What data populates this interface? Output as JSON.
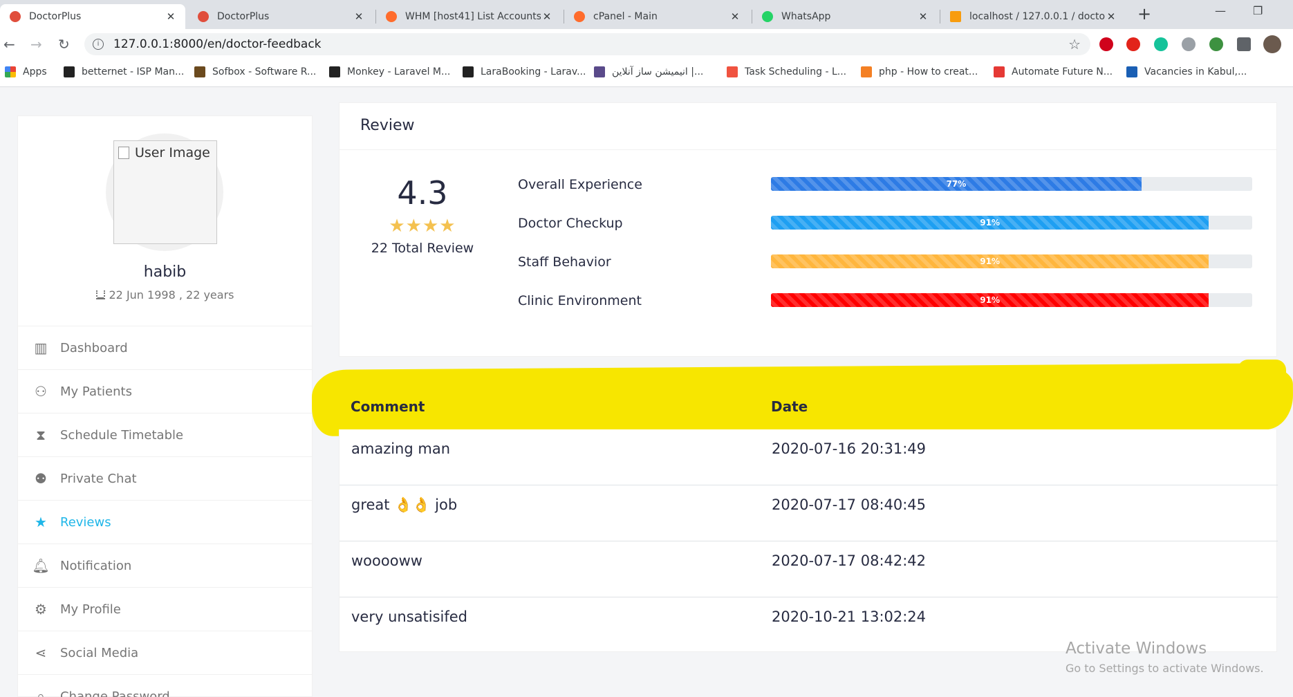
{
  "browser": {
    "tabs": [
      {
        "title": "DoctorPlus",
        "active": true
      },
      {
        "title": "DoctorPlus",
        "active": false
      },
      {
        "title": "WHM [host41] List Accounts",
        "active": false
      },
      {
        "title": "cPanel - Main",
        "active": false
      },
      {
        "title": "WhatsApp",
        "active": false
      },
      {
        "title": "localhost / 127.0.0.1 / doctor",
        "active": false
      }
    ],
    "url": "127.0.0.1:8000/en/doctor-feedback",
    "bookmarks": [
      "Apps",
      "betternet - ISP Man...",
      "Sofbox - Software R...",
      "Monkey - Laravel M...",
      "LaraBooking - Larav...",
      "انیمیشن ساز آنلاین |...",
      "Task Scheduling - L...",
      "php - How to creat...",
      "Automate Future N...",
      "Vacancies in Kabul,..."
    ],
    "extensions": [
      "abp-icon",
      "shield-icon",
      "grammarly-icon",
      "cloud-icon",
      "globe-icon",
      "puzzle-icon",
      "avatar"
    ]
  },
  "profile": {
    "image_alt": "User Image",
    "name": "habib",
    "dob": "22 Jun 1998 , 22 years"
  },
  "menu": [
    {
      "label": "Dashboard",
      "icon": "dashboard-icon",
      "active": false
    },
    {
      "label": "My Patients",
      "icon": "patients-icon",
      "active": false
    },
    {
      "label": "Schedule Timetable",
      "icon": "hourglass-icon",
      "active": false
    },
    {
      "label": "Private Chat",
      "icon": "chat-icon",
      "active": false
    },
    {
      "label": "Reviews",
      "icon": "star-icon",
      "active": true
    },
    {
      "label": "Notification",
      "icon": "bell-icon",
      "active": false
    },
    {
      "label": "My Profile",
      "icon": "user-cog-icon",
      "active": false
    },
    {
      "label": "Social Media",
      "icon": "share-icon",
      "active": false
    },
    {
      "label": "Change Password",
      "icon": "lock-icon",
      "active": false
    }
  ],
  "review": {
    "title": "Review",
    "rating": "4.3",
    "stars": "★★★★",
    "total": "22 Total Review",
    "metrics": [
      {
        "label": "Overall Experience",
        "percent": 77,
        "text": "77%",
        "color": "#2d7be5"
      },
      {
        "label": "Doctor Checkup",
        "percent": 91,
        "text": "91%",
        "color": "#1e9ff2"
      },
      {
        "label": "Staff Behavior",
        "percent": 91,
        "text": "91%",
        "color": "#ffb63d"
      },
      {
        "label": "Clinic Environment",
        "percent": 91,
        "text": "91%",
        "color": "#ff0000"
      }
    ]
  },
  "comments": {
    "headers": {
      "comment": "Comment",
      "date": "Date"
    },
    "rows": [
      {
        "comment": "amazing man",
        "date": "2020-07-16 20:31:49"
      },
      {
        "comment": "great 👌👌 job",
        "date": "2020-07-17 08:40:45"
      },
      {
        "comment": "wooooww",
        "date": "2020-07-17 08:42:42"
      },
      {
        "comment": "very unsatisifed",
        "date": "2020-10-21 13:02:24"
      }
    ]
  },
  "watermark": {
    "line1": "Activate Windows",
    "line2": "Go to Settings to activate Windows."
  },
  "colors": {
    "accent": "#1fb6e8",
    "highlight": "#f7e600",
    "star": "#f4c150"
  }
}
